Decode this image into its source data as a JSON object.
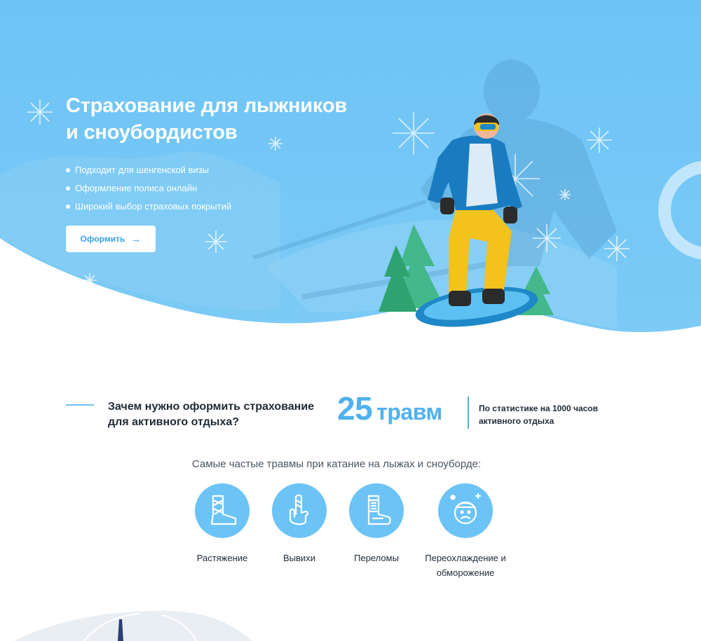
{
  "hero": {
    "title": "Страхование для лыжников и сноубордистов",
    "features": [
      "Подходит для шенгенской визы",
      "Оформление полиса онлайн",
      "Широкий выбор страховых покрытий"
    ],
    "cta_label": "Оформить",
    "cta_icon": "arrow-right-icon"
  },
  "why": {
    "title": "Зачем нужно оформить страхование для активного отдыха?",
    "stat_value": "25",
    "stat_unit": "травм",
    "stat_note": "По  статистике на 1000 часов активного отдыха"
  },
  "injuries": {
    "title": "Самые частые травмы при катание на лыжах и сноуборде:",
    "items": [
      {
        "label": "Растяжение",
        "icon": "bandaged-foot-icon"
      },
      {
        "label": "Вывихи",
        "icon": "bandaged-finger-icon"
      },
      {
        "label": "Переломы",
        "icon": "leg-cast-icon"
      },
      {
        "label": "Переохлаждение и обморожение",
        "icon": "frozen-face-icon"
      }
    ]
  },
  "colors": {
    "hero_bg": "#6ec2f5",
    "accent": "#4fb1ef",
    "circle": "#6cc3f6",
    "text_dark": "#1f2a37"
  }
}
